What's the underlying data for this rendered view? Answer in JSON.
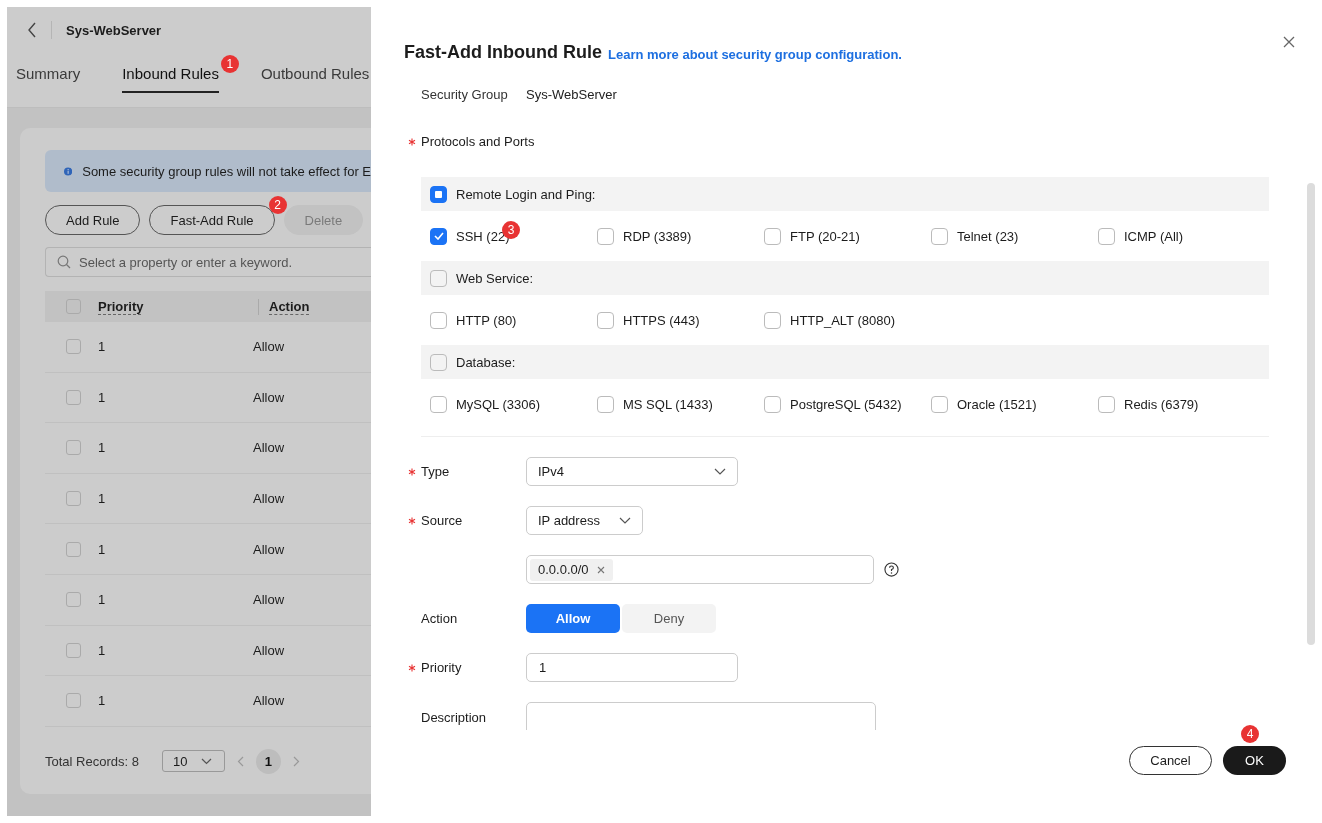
{
  "page": {
    "title": "Sys-WebServer",
    "tabs": [
      {
        "label": "Summary",
        "selected": false
      },
      {
        "label": "Inbound Rules",
        "selected": true,
        "marker": "1"
      },
      {
        "label": "Outbound Rules",
        "selected": false
      }
    ],
    "notice": "Some security group rules will not take effect for E",
    "buttons": [
      {
        "label": "Add Rule",
        "disabled": false
      },
      {
        "label": "Fast-Add Rule",
        "disabled": false,
        "marker": "2"
      },
      {
        "label": "Delete",
        "disabled": true
      }
    ],
    "search": {
      "placeholder": "Select a property or enter a keyword."
    },
    "table": {
      "columns": [
        "Priority",
        "Action"
      ],
      "all_checked": false,
      "rows": [
        {
          "checked": false,
          "cells": [
            "1",
            "Allow"
          ]
        },
        {
          "checked": false,
          "cells": [
            "1",
            "Allow"
          ]
        },
        {
          "checked": false,
          "cells": [
            "1",
            "Allow"
          ]
        },
        {
          "checked": false,
          "cells": [
            "1",
            "Allow"
          ]
        },
        {
          "checked": false,
          "cells": [
            "1",
            "Allow"
          ]
        },
        {
          "checked": false,
          "cells": [
            "1",
            "Allow"
          ]
        },
        {
          "checked": false,
          "cells": [
            "1",
            "Allow"
          ]
        },
        {
          "checked": false,
          "cells": [
            "1",
            "Allow"
          ]
        }
      ]
    },
    "pagination": {
      "total": "Total Records: 8",
      "page_size": "10",
      "pages": [
        {
          "label": "1",
          "selected": true
        }
      ]
    }
  },
  "dialog": {
    "title": "Fast-Add Inbound Rule",
    "link": "Learn more about security group configuration.",
    "security_group": {
      "label": "Security Group",
      "value": "Sys-WebServer"
    },
    "protocols": {
      "label": "Protocols and Ports",
      "required": true,
      "groups": [
        {
          "label": "Remote Login and Ping:",
          "indeterminate": true,
          "options": [
            {
              "label": "SSH (22)",
              "checked": true,
              "marker": "3"
            },
            {
              "label": "RDP (3389)",
              "checked": false
            },
            {
              "label": "FTP (20-21)",
              "checked": false
            },
            {
              "label": "Telnet (23)",
              "checked": false
            },
            {
              "label": "ICMP (All)",
              "checked": false
            }
          ]
        },
        {
          "label": "Web Service:",
          "indeterminate": false,
          "options": [
            {
              "label": "HTTP (80)",
              "checked": false
            },
            {
              "label": "HTTPS (443)",
              "checked": false
            },
            {
              "label": "HTTP_ALT (8080)",
              "checked": false
            }
          ]
        },
        {
          "label": "Database:",
          "indeterminate": false,
          "options": [
            {
              "label": "MySQL (3306)",
              "checked": false
            },
            {
              "label": "MS SQL (1433)",
              "checked": false
            },
            {
              "label": "PostgreSQL (5432)",
              "checked": false
            },
            {
              "label": "Oracle (1521)",
              "checked": false
            },
            {
              "label": "Redis (6379)",
              "checked": false
            }
          ]
        }
      ]
    },
    "type": {
      "label": "Type",
      "required": true,
      "value": "IPv4"
    },
    "source": {
      "label": "Source",
      "required": true,
      "value": "IP address",
      "tags": [
        "0.0.0.0/0"
      ]
    },
    "action": {
      "label": "Action",
      "required": false,
      "options": [
        {
          "label": "Allow",
          "selected": true
        },
        {
          "label": "Deny",
          "selected": false
        }
      ]
    },
    "priority": {
      "label": "Priority",
      "required": true,
      "value": "1"
    },
    "description": {
      "label": "Description",
      "required": false
    },
    "footer": [
      {
        "label": "Cancel",
        "kind": "secondary"
      },
      {
        "label": "OK",
        "kind": "primary",
        "marker": "4"
      }
    ]
  }
}
